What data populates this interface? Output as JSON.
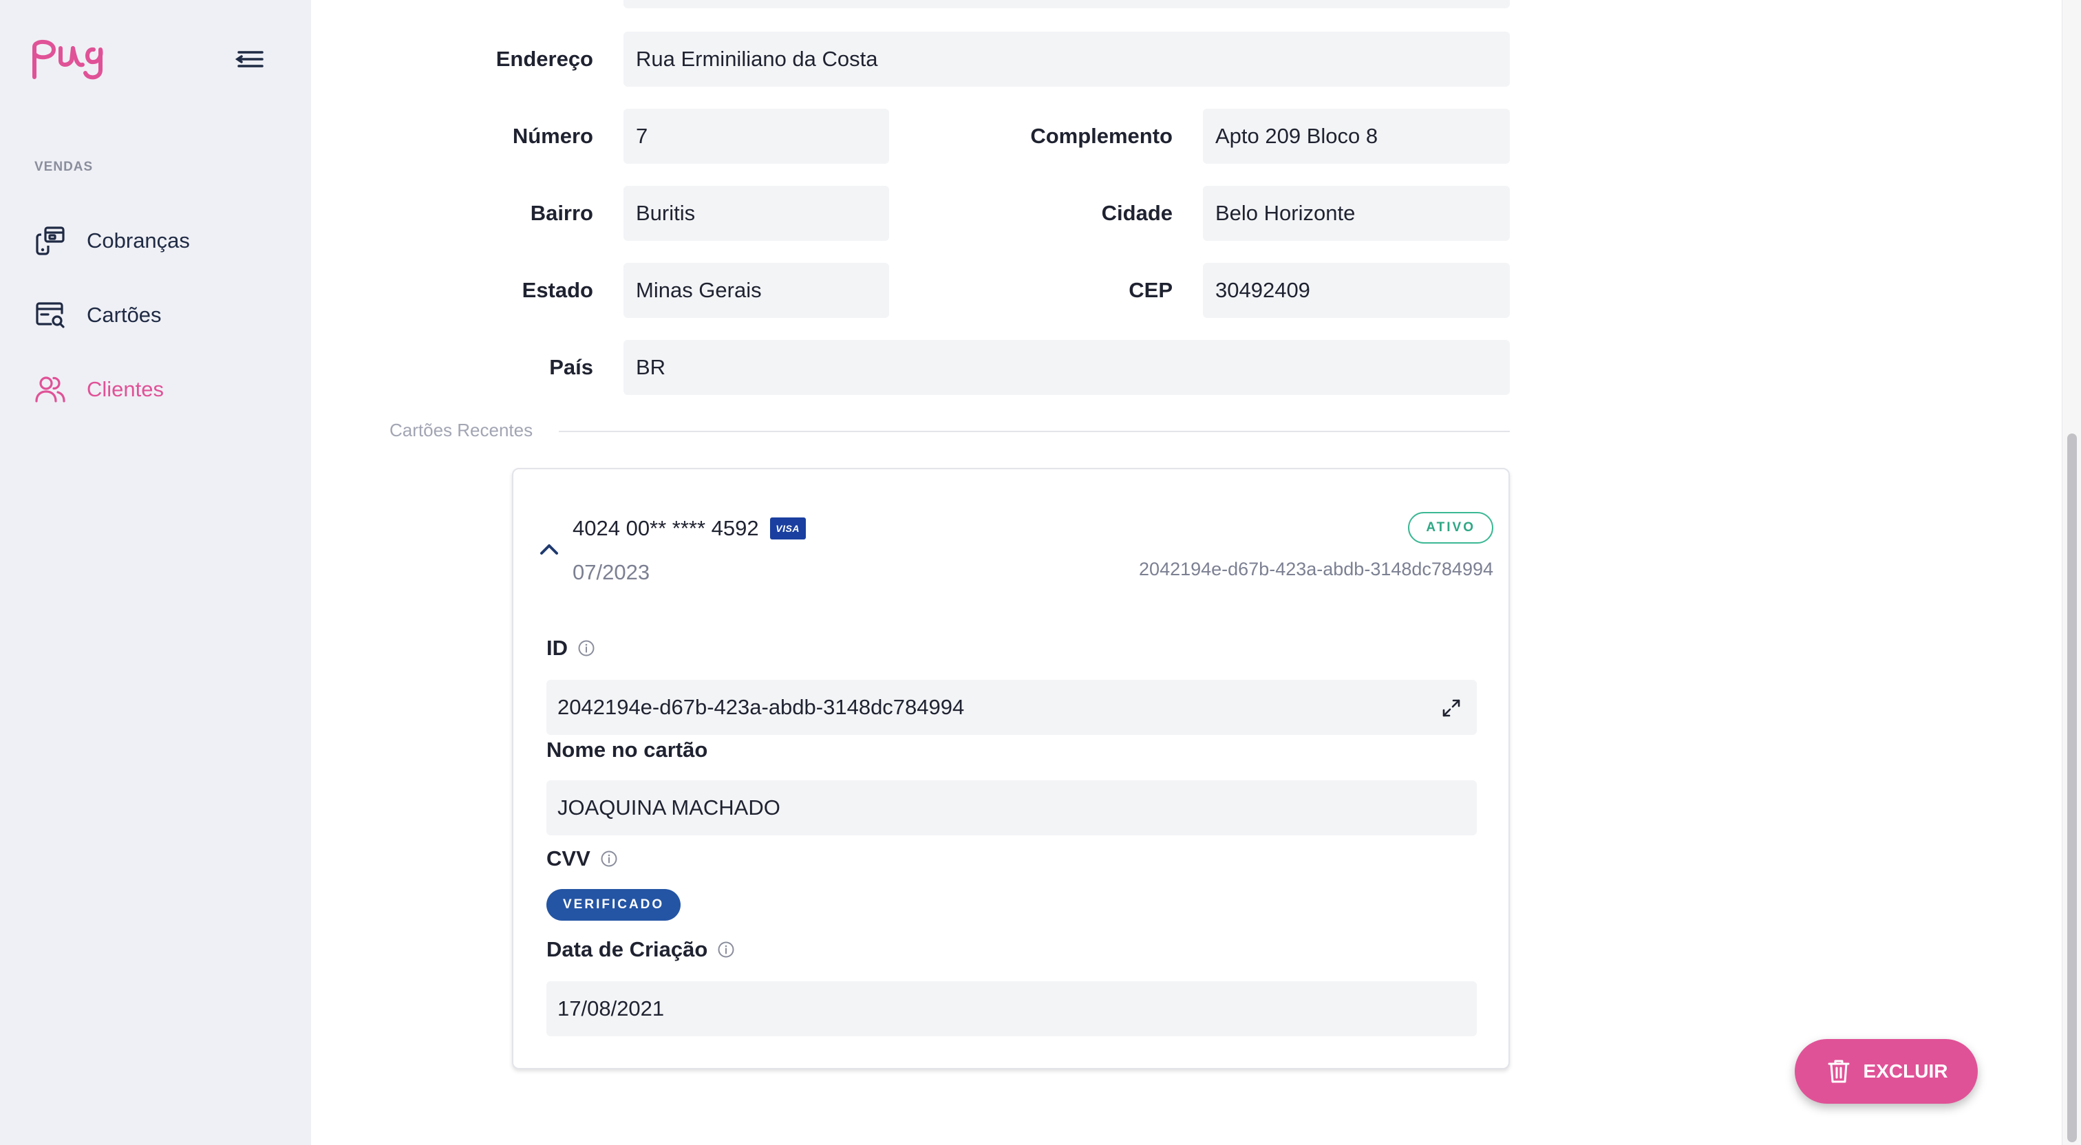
{
  "sidebar": {
    "section_label": "VENDAS",
    "items": [
      {
        "label": "Cobranças",
        "icon": "charges-icon"
      },
      {
        "label": "Cartões",
        "icon": "card-search-icon"
      },
      {
        "label": "Clientes",
        "icon": "users-icon"
      }
    ],
    "active_item": "Clientes"
  },
  "address": {
    "endereco_label": "Endereço",
    "endereco_value": "Rua Erminiliano da Costa",
    "numero_label": "Número",
    "numero_value": "7",
    "complemento_label": "Complemento",
    "complemento_value": "Apto 209 Bloco 8",
    "bairro_label": "Bairro",
    "bairro_value": "Buritis",
    "cidade_label": "Cidade",
    "cidade_value": "Belo Horizonte",
    "estado_label": "Estado",
    "estado_value": "Minas Gerais",
    "cep_label": "CEP",
    "cep_value": "30492409",
    "pais_label": "País",
    "pais_value": "BR"
  },
  "recent_cards": {
    "section_label": "Cartões Recentes",
    "card": {
      "number": "4024 00** **** 4592",
      "brand": "VISA",
      "expiry": "07/2023",
      "status": "ATIVO",
      "id_short": "2042194e-d67b-423a-abdb-3148dc784994",
      "id_label": "ID",
      "id_value": "2042194e-d67b-423a-abdb-3148dc784994",
      "name_label": "Nome no cartão",
      "name_value": "JOAQUINA MACHADO",
      "cvv_label": "CVV",
      "cvv_status": "VERIFICADO",
      "created_label": "Data de Criação",
      "created_value": "17/08/2021"
    }
  },
  "actions": {
    "delete_label": "EXCLUIR"
  },
  "colors": {
    "brand_pink": "#e05297",
    "sidebar_bg": "#eff0f5",
    "active_green": "#2ea784",
    "verified_blue": "#2455a4"
  }
}
